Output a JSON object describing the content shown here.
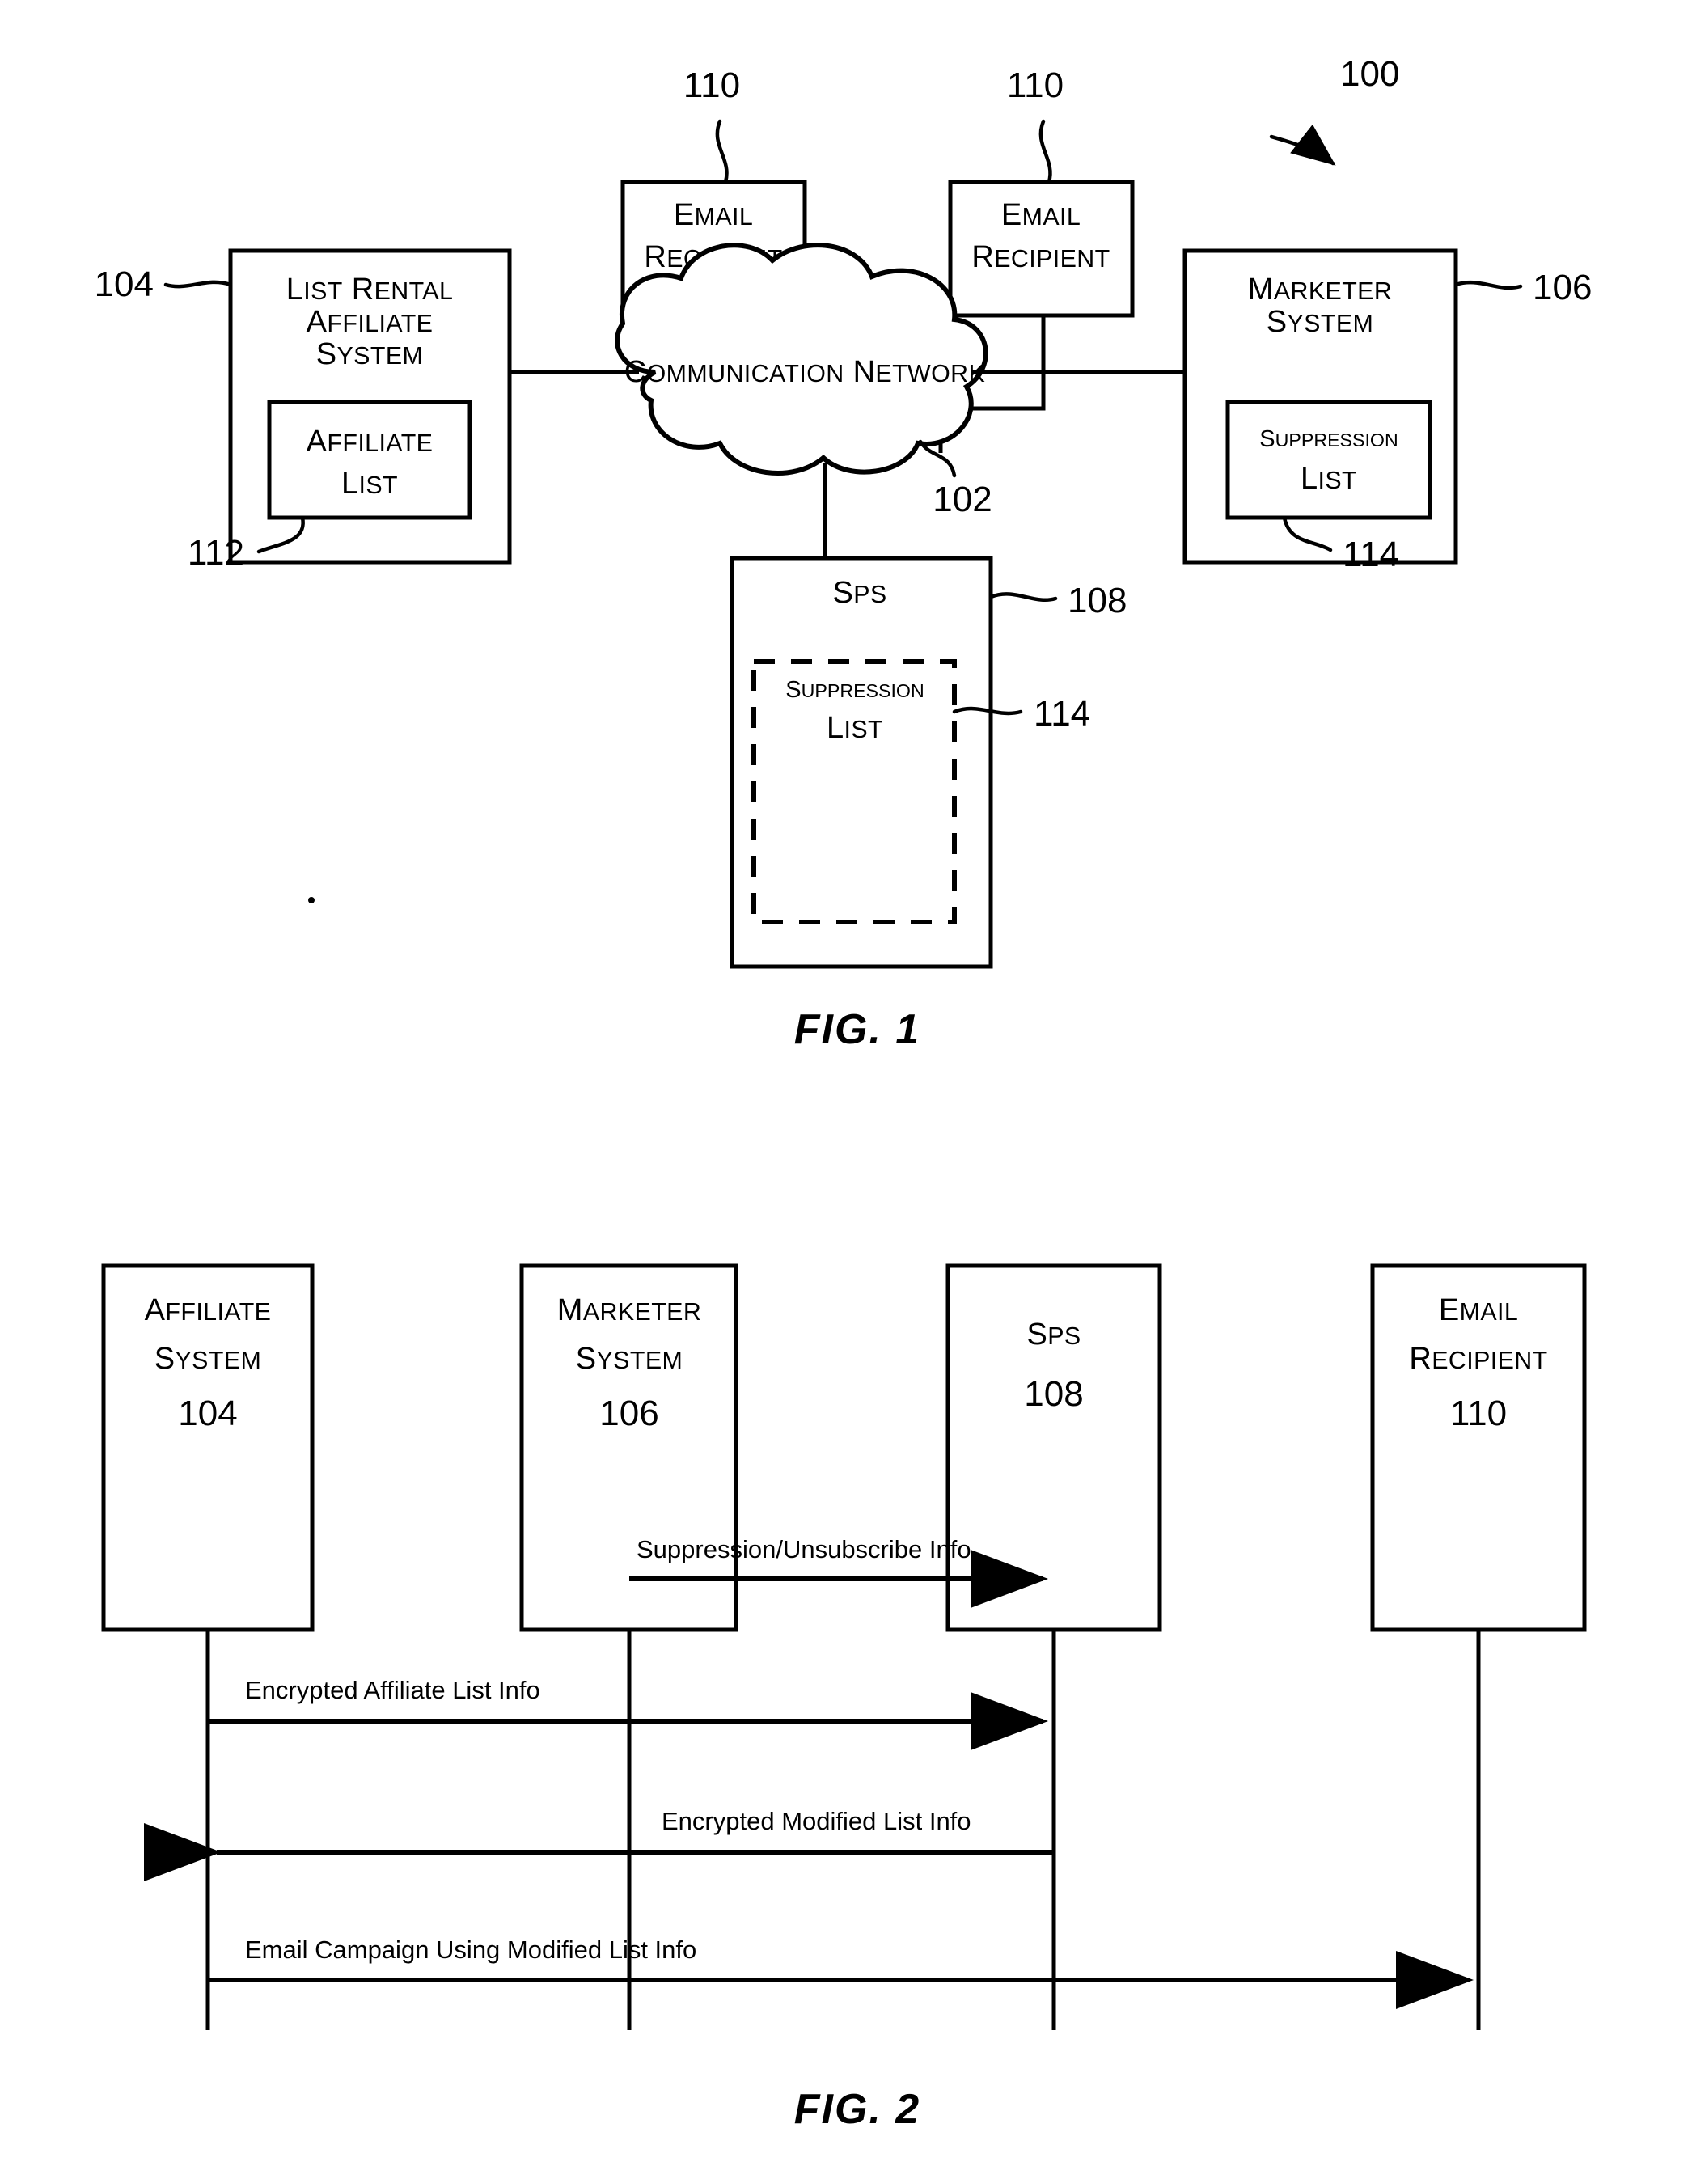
{
  "figure1": {
    "caption": "FIG. 1",
    "system_ref": "100",
    "nodes": {
      "email_recipient_left": {
        "line1": "Email",
        "line2": "Recipient",
        "ref": "110"
      },
      "email_recipient_right": {
        "line1": "Email",
        "line2": "Recipient",
        "ref": "110"
      },
      "affiliate_system": {
        "line1": "List Rental",
        "line2": "Affiliate",
        "line3": "System",
        "ref": "104",
        "inner": {
          "line1": "Affiliate",
          "line2": "List",
          "ref": "112"
        }
      },
      "communication_network": {
        "label": "Communication Network",
        "ref": "102"
      },
      "marketer_system": {
        "line1": "Marketer",
        "line2": "System",
        "ref": "106",
        "inner": {
          "line1": "Suppression",
          "line2": "List",
          "ref": "114"
        }
      },
      "sps": {
        "label": "SPS",
        "ref": "108",
        "inner": {
          "line1": "Suppression",
          "line2": "List",
          "ref": "114"
        }
      }
    }
  },
  "figure2": {
    "caption": "FIG. 2",
    "participants": [
      {
        "line1": "Affiliate",
        "line2": "System",
        "ref": "104"
      },
      {
        "line1": "Marketer",
        "line2": "System",
        "ref": "106"
      },
      {
        "line1": "SPS",
        "line2": "",
        "ref": "108"
      },
      {
        "line1": "Email",
        "line2": "Recipient",
        "ref": "110"
      }
    ],
    "messages": [
      {
        "label": "Suppression/Unsubscribe Info",
        "from": "Marketer System",
        "to": "SPS",
        "direction": "right"
      },
      {
        "label": "Encrypted Affiliate List Info",
        "from": "Affiliate System",
        "to": "SPS",
        "direction": "right"
      },
      {
        "label": "Encrypted Modified List Info",
        "from": "SPS",
        "to": "Affiliate System",
        "direction": "left"
      },
      {
        "label": "Email Campaign Using Modified List Info",
        "from": "Affiliate System",
        "to": "Email Recipient",
        "direction": "right"
      }
    ]
  },
  "colors": {
    "ink": "#000000",
    "paper": "#ffffff"
  }
}
